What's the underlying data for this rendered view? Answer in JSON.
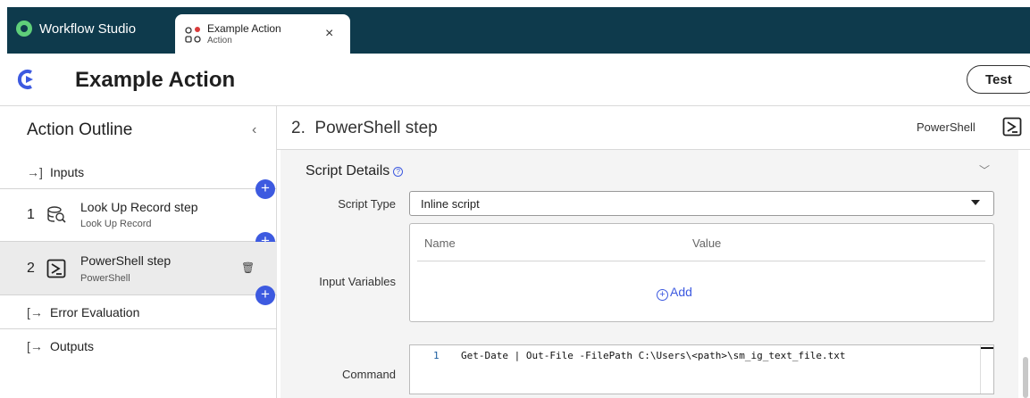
{
  "app": {
    "brand": "Workflow Studio"
  },
  "tab": {
    "title": "Example Action",
    "subtitle": "Action",
    "close": "×"
  },
  "header": {
    "title": "Example Action",
    "test_label": "Test"
  },
  "sidebar": {
    "title": "Action Outline",
    "collapse": "‹",
    "inputs_label": "Inputs",
    "steps": [
      {
        "number": "1",
        "title": "Look Up Record step",
        "subtitle": "Look Up Record",
        "icon": "lookup-record-icon"
      },
      {
        "number": "2",
        "title": "PowerShell step",
        "subtitle": "PowerShell",
        "icon": "powershell-icon"
      }
    ],
    "error_label": "Error Evaluation",
    "outputs_label": "Outputs",
    "add_symbol": "+"
  },
  "main": {
    "step_heading": "2.  PowerShell step",
    "step_type": "PowerShell",
    "section_title": "Script Details",
    "script_type_label": "Script Type",
    "script_type_value": "Inline script",
    "input_vars_label": "Input Variables",
    "col_name": "Name",
    "col_value": "Value",
    "add_label": "Add",
    "command_label": "Command",
    "command_line_no": "1",
    "command_code": "Get-Date | Out-File -FilePath C:\\Users\\<path>\\sm_ig_text_file.txt"
  },
  "colors": {
    "topbar": "#0e3a4c",
    "accent": "#3d5ae0",
    "brand_logo": "#5fcf7a"
  }
}
